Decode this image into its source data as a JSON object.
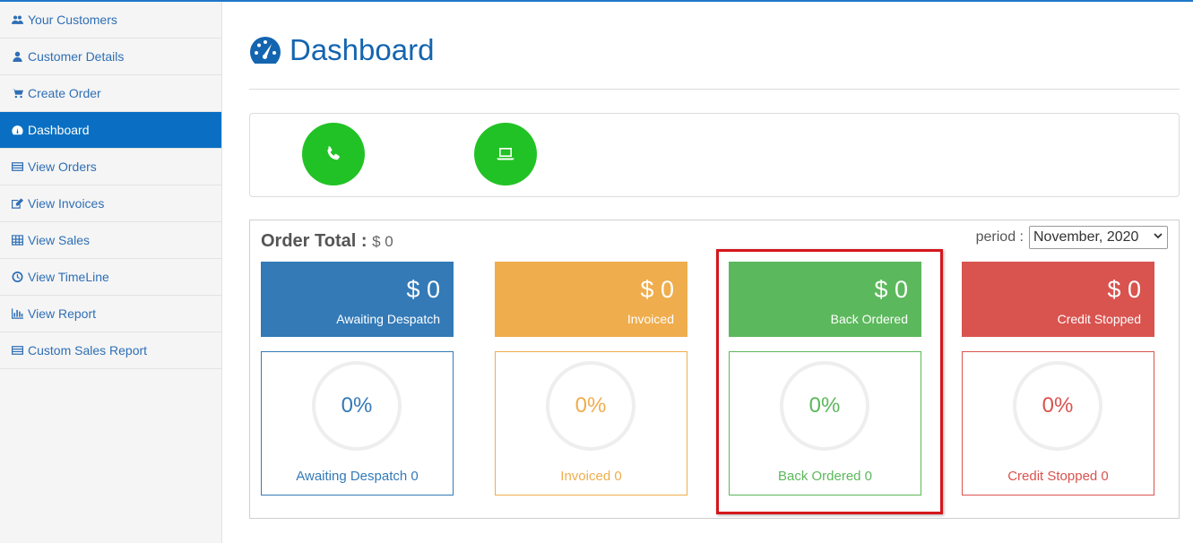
{
  "sidebar": {
    "items": [
      {
        "label": "Your Customers",
        "icon": "users-icon"
      },
      {
        "label": "Customer Details",
        "icon": "user-icon"
      },
      {
        "label": "Create Order",
        "icon": "cart-icon"
      },
      {
        "label": "Dashboard",
        "icon": "dashboard-icon",
        "active": true
      },
      {
        "label": "View Orders",
        "icon": "list-icon"
      },
      {
        "label": "View Invoices",
        "icon": "edit-icon"
      },
      {
        "label": "View Sales",
        "icon": "table-icon"
      },
      {
        "label": "View TimeLine",
        "icon": "clock-icon"
      },
      {
        "label": "View Report",
        "icon": "bar-chart-icon"
      },
      {
        "label": "Custom Sales Report",
        "icon": "list-icon"
      }
    ]
  },
  "header": {
    "title": "Dashboard",
    "icon": "dashboard-icon"
  },
  "quick_icons": [
    {
      "icon": "phone-icon",
      "color": "#21c225"
    },
    {
      "icon": "laptop-icon",
      "color": "#21c225"
    }
  ],
  "order_total": {
    "label": "Order Total :",
    "value": "$ 0"
  },
  "period": {
    "label": "period :",
    "selected": "November, 2020"
  },
  "cards": [
    {
      "amount": "$ 0",
      "label": "Awaiting Despatch",
      "percent": "0%",
      "count_label": "Awaiting Despatch 0",
      "color": "#337ab7"
    },
    {
      "amount": "$ 0",
      "label": "Invoiced",
      "percent": "0%",
      "count_label": "Invoiced 0",
      "color": "#efad4d"
    },
    {
      "amount": "$ 0",
      "label": "Back Ordered",
      "percent": "0%",
      "count_label": "Back Ordered 0",
      "color": "#5cb85c"
    },
    {
      "amount": "$ 0",
      "label": "Credit Stopped",
      "percent": "0%",
      "count_label": "Credit Stopped 0",
      "color": "#d9534f"
    }
  ],
  "colors": {
    "accent": "#0a6fc2",
    "title": "#1465b0",
    "highlight": "#d4171c"
  }
}
